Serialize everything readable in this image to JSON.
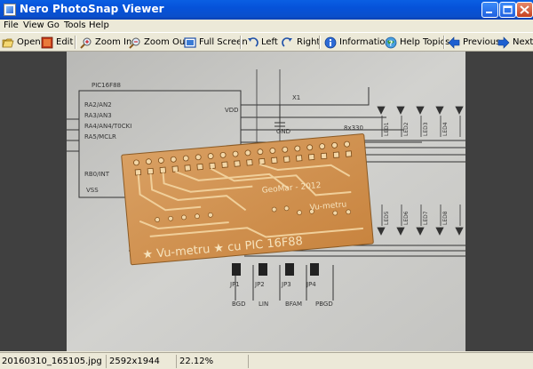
{
  "window": {
    "title": "Nero PhotoSnap Viewer",
    "controls": [
      "minimize",
      "maximize",
      "close"
    ]
  },
  "menu": {
    "items": [
      "File",
      "View",
      "Go",
      "Tools",
      "Help"
    ]
  },
  "toolbar": {
    "open": "Open",
    "edit": "Edit",
    "zoom_in": "Zoom In",
    "zoom_out": "Zoom Out",
    "full_screen": "Full Screen",
    "left": "Left",
    "right": "Right",
    "information": "Information",
    "help_topics": "Help Topics",
    "previous": "Previous",
    "next": "Next"
  },
  "image": {
    "labels": {
      "chip_name": "PIC16F88",
      "pins_left": [
        "RA2/AN2",
        "RA3/AN3",
        "RA4/AN4/T0CKI",
        "RA5/MCLR",
        "RB0/INT"
      ],
      "vdd": "VDD",
      "vss": "VSS",
      "gnd": "GND",
      "resistor": "8x330",
      "crystal": "X1",
      "board_signature": "GeoMar - 2012",
      "board_title": "Vu-metru",
      "board_banner": "★ Vu-metru ★ cu PIC 16F88",
      "jumpers": [
        "JP1",
        "JP2",
        "JP3",
        "JP4"
      ],
      "jumper_labels": [
        "BGD",
        "LIN",
        "BFAM",
        "PBGD"
      ],
      "led_labels": [
        "LED1",
        "LED2",
        "LED3",
        "LED4",
        "LED5",
        "LED6",
        "LED7",
        "LED8"
      ]
    }
  },
  "status": {
    "filename": "20160310_165105.jpg",
    "dimensions": "2592x1944",
    "zoom": "22.12%"
  },
  "colors": {
    "titlebar": "#0A4FCB",
    "chrome": "#ECE9D8",
    "viewport": "#404040",
    "pcb_copper": "#D9A063",
    "pcb_board": "#C8843F"
  }
}
